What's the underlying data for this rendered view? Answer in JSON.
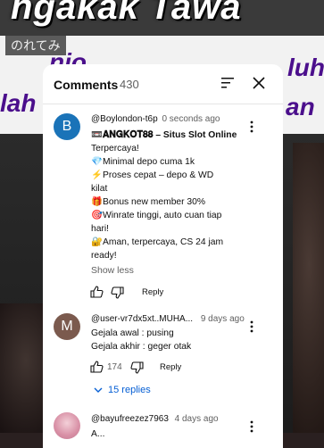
{
  "video": {
    "overlay_title": "ngakak Tawa",
    "overlay_jp": "のれてみ",
    "overlay_line1": "nio",
    "overlay_line2": "lah",
    "overlay_right1": "luh",
    "overlay_right2": "an"
  },
  "panel": {
    "title": "Comments",
    "count": "430"
  },
  "comments": [
    {
      "avatar_letter": "B",
      "avatar_color": "#1a73b8",
      "author": "@Boylondon-t6p",
      "time": "0 seconds ago",
      "lines": [
        {
          "icon": "📼",
          "text": "𝐀𝐍𝐆𝐊𝐎𝐓𝟖𝟖 – Situs Slot Online"
        },
        {
          "icon": "",
          "text": "Terpercaya!"
        },
        {
          "icon": "💎",
          "text": "Minimal depo cuma 1k"
        },
        {
          "icon": "⚡",
          "text": "Proses cepat – depo & WD"
        },
        {
          "icon": "",
          "text": "kilat"
        },
        {
          "icon": "🎁",
          "text": "Bonus new member 30%"
        },
        {
          "icon": "🎯",
          "text": "Winrate tinggi, auto cuan tiap"
        },
        {
          "icon": "",
          "text": "hari!"
        },
        {
          "icon": "🔐",
          "text": "Aman, terpercaya, CS 24 jam"
        },
        {
          "icon": "",
          "text": "ready!"
        }
      ],
      "show_less": "Show less",
      "reply_label": "Reply"
    },
    {
      "avatar_letter": "M",
      "avatar_color": "#7b5a4e",
      "author": "@user-vr7dx5xt..MUHA...",
      "time": "9 days ago",
      "lines": [
        {
          "icon": "",
          "text": "Gejala awal : pusing"
        },
        {
          "icon": "",
          "text": "Gejala akhir : geger otak"
        }
      ],
      "likes": "174",
      "reply_label": "Reply",
      "replies_toggle": "15 replies"
    },
    {
      "author": "@bayufreezez7963",
      "time": "4 days ago",
      "lines": [
        {
          "icon": "",
          "text": "A..."
        }
      ]
    }
  ],
  "colors": {
    "link_blue": "#065fd4",
    "text_primary": "#0f0f0f",
    "text_secondary": "#606060"
  }
}
